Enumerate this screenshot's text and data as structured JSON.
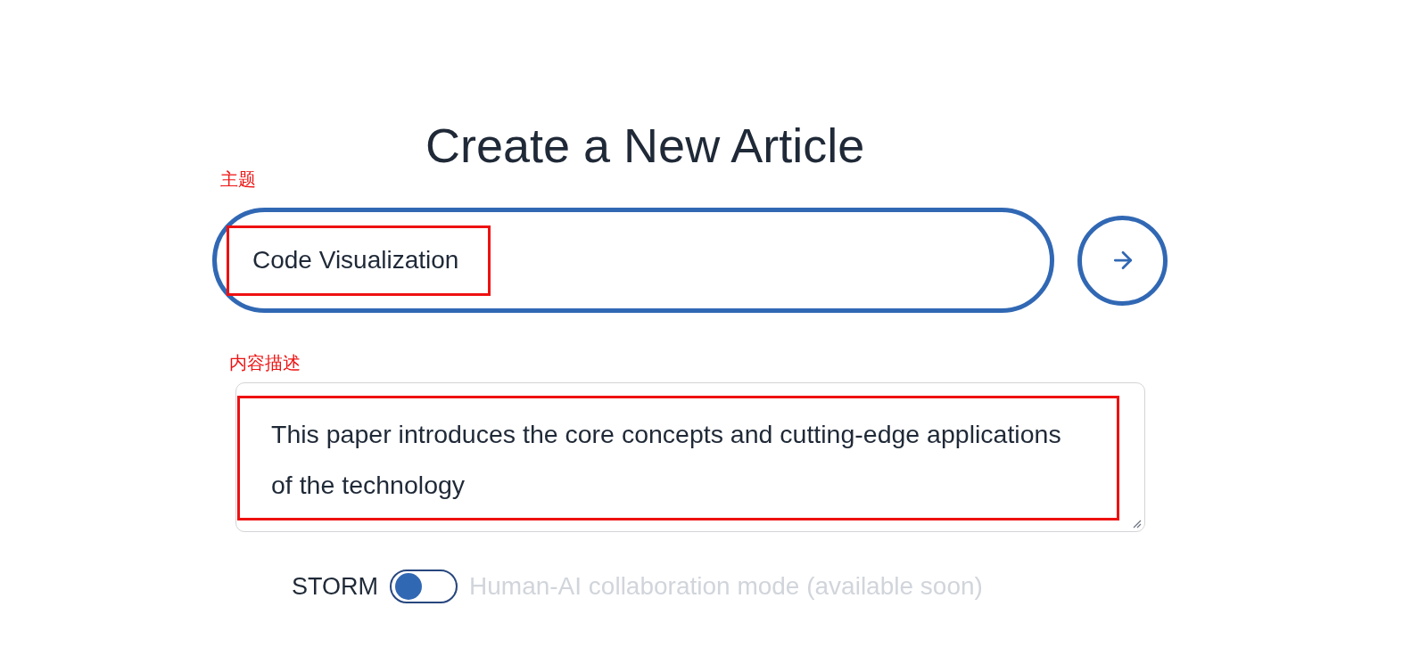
{
  "page": {
    "title": "Create a New Article"
  },
  "topic": {
    "annotation_label": "主题",
    "value": "Code Visualization",
    "highlighted": true
  },
  "description": {
    "annotation_label": "内容描述",
    "value": "This paper introduces the core concepts and cutting-edge applications of the technology",
    "highlighted": true
  },
  "mode_switch": {
    "label": "STORM",
    "on": false,
    "option_label": "Human-AI collaboration mode (available soon)",
    "option_disabled": true
  }
}
